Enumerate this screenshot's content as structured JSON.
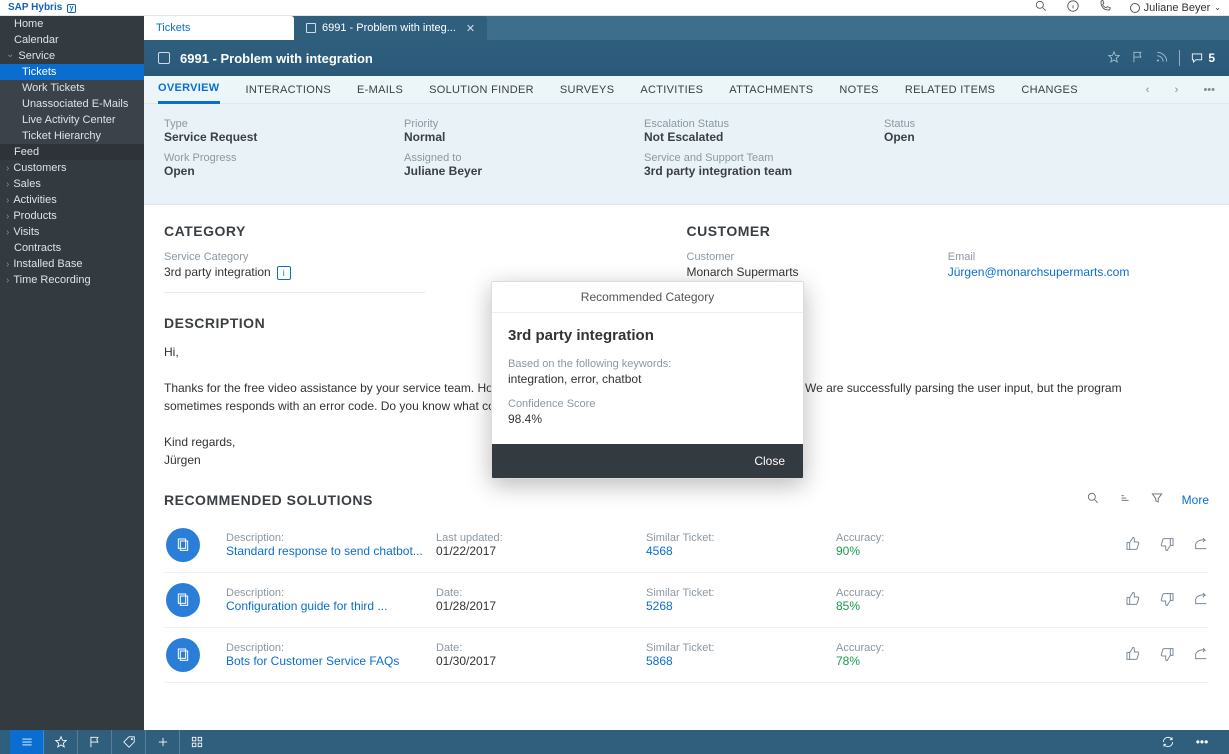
{
  "brand": "SAP Hybris",
  "user": "Juliane Beyer",
  "sidebar": {
    "items": [
      {
        "label": "Home"
      },
      {
        "label": "Calendar"
      },
      {
        "label": "Service"
      },
      {
        "label": "Tickets"
      },
      {
        "label": "Work Tickets"
      },
      {
        "label": "Unassociated E-Mails"
      },
      {
        "label": "Live Activity Center"
      },
      {
        "label": "Ticket Hierarchy"
      },
      {
        "label": "Feed"
      },
      {
        "label": "Customers"
      },
      {
        "label": "Sales"
      },
      {
        "label": "Activities"
      },
      {
        "label": "Products"
      },
      {
        "label": "Visits"
      },
      {
        "label": "Contracts"
      },
      {
        "label": "Installed Base"
      },
      {
        "label": "Time Recording"
      }
    ]
  },
  "tabs": {
    "base": "Tickets",
    "active": "6991 - Problem with integ..."
  },
  "title": "6991 - Problem with integration",
  "comment_count": "5",
  "subtabs": [
    "OVERVIEW",
    "INTERACTIONS",
    "E-MAILS",
    "SOLUTION FINDER",
    "SURVEYS",
    "ACTIVITIES",
    "ATTACHMENTS",
    "NOTES",
    "RELATED ITEMS",
    "CHANGES"
  ],
  "meta": {
    "type_lbl": "Type",
    "type": "Service Request",
    "priority_lbl": "Priority",
    "priority": "Normal",
    "escalation_lbl": "Escalation Status",
    "escalation": "Not Escalated",
    "status_lbl": "Status",
    "status": "Open",
    "progress_lbl": "Work Progress",
    "progress": "Open",
    "assigned_lbl": "Assigned to",
    "assigned": "Juliane Beyer",
    "team_lbl": "Service and Support Team",
    "team": "3rd party integration team"
  },
  "category": {
    "title": "CATEGORY",
    "service_lbl": "Service Category",
    "service": "3rd party integration"
  },
  "customer": {
    "title": "CUSTOMER",
    "cust_lbl": "Customer",
    "cust": "Monarch Supermarts",
    "email_lbl": "Email",
    "email": "Jürgen@monarchsupermarts.com"
  },
  "description": {
    "title": "DESCRIPTION",
    "greeting": "Hi,",
    "body": "Thanks for the free video assistance by your service team. However, we have another issue with our chatbot integration. We are successfully parsing the user input, but the program sometimes responds with an error code. Do you know what could be the problem with responses in the chatbot?",
    "signoff": "Kind regards,",
    "name": "Jürgen"
  },
  "rec": {
    "title": "RECOMMENDED SOLUTIONS",
    "more": "More",
    "rows": [
      {
        "desc_lbl": "Description:",
        "desc": "Standard response to send chatbot...",
        "date_lbl": "Last updated:",
        "date": "01/22/2017",
        "tkt_lbl": "Similar Ticket:",
        "tkt": "4568",
        "acc_lbl": "Accuracy:",
        "acc": "90%"
      },
      {
        "desc_lbl": "Description:",
        "desc": "Configuration guide for third ...",
        "date_lbl": "Date:",
        "date": "01/28/2017",
        "tkt_lbl": "Similar Ticket:",
        "tkt": "5268",
        "acc_lbl": "Accuracy:",
        "acc": "85%"
      },
      {
        "desc_lbl": "Description:",
        "desc": "Bots for Customer Service FAQs",
        "date_lbl": "Date:",
        "date": "01/30/2017",
        "tkt_lbl": "Similar Ticket:",
        "tkt": "5868",
        "acc_lbl": "Accuracy:",
        "acc": "78%"
      }
    ]
  },
  "modal": {
    "title": "Recommended Category",
    "heading": "3rd party integration",
    "kw_lbl": "Based on the following keywords:",
    "kw": "integration, error, chatbot",
    "conf_lbl": "Confidence Score",
    "conf": "98.4%",
    "close": "Close"
  }
}
